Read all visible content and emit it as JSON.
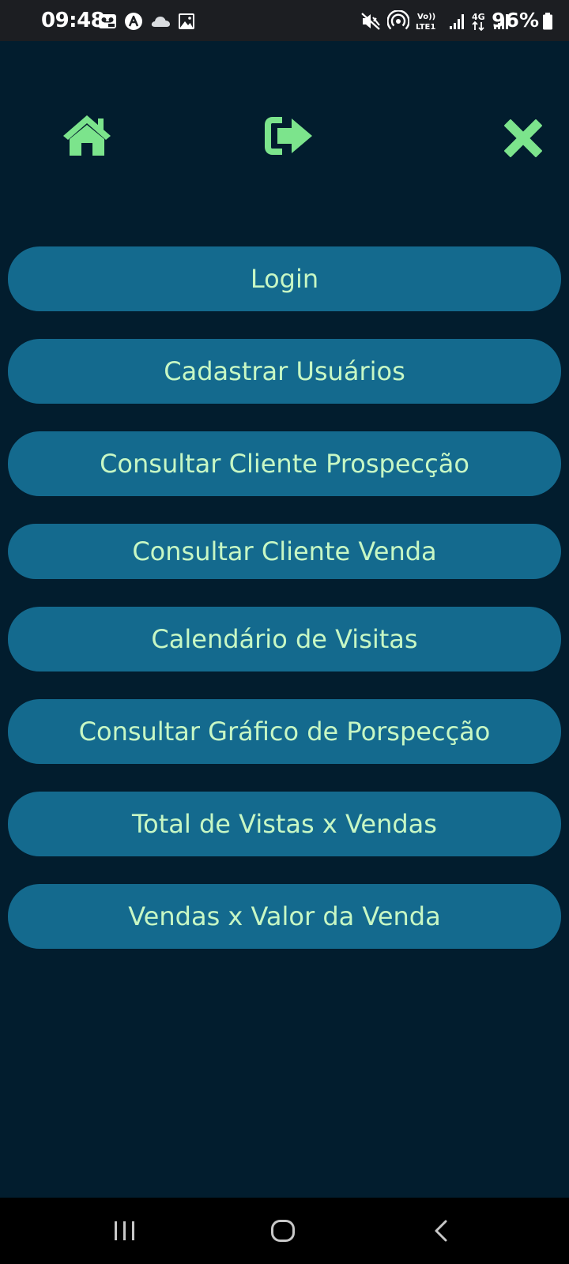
{
  "status_bar": {
    "time": "09:48",
    "battery": "96%",
    "left_icons": [
      "voicemail-icon",
      "app-icon",
      "cloud-icon",
      "image-icon"
    ],
    "right_icons": [
      "mute-icon",
      "hotspot-icon",
      "volte-icon",
      "signal-icon",
      "signal-4g-icon",
      "signal-icon"
    ],
    "volte_top": "Vo))",
    "volte_bottom": "LTE1",
    "net_label": "4G"
  },
  "nav": {
    "home_icon": "home-icon",
    "logout_icon": "sign-out-icon",
    "close_icon": "close-icon"
  },
  "menu": {
    "items": [
      {
        "label": "Login"
      },
      {
        "label": "Cadastrar Usuários"
      },
      {
        "label": "Consultar Cliente Prospecção"
      },
      {
        "label": "Consultar Cliente Venda"
      },
      {
        "label": "Calendário de Visitas"
      },
      {
        "label": "Consultar Gráfico de Porspecção"
      },
      {
        "label": "Total de Vistas x Vendas"
      },
      {
        "label": "Vendas x Valor da Venda"
      }
    ]
  },
  "colors": {
    "background": "#021d2e",
    "button": "#146a8e",
    "button_text": "#c7f7c4",
    "icon": "#7ce48c"
  },
  "system_nav": [
    "recents-button",
    "home-button",
    "back-button"
  ]
}
